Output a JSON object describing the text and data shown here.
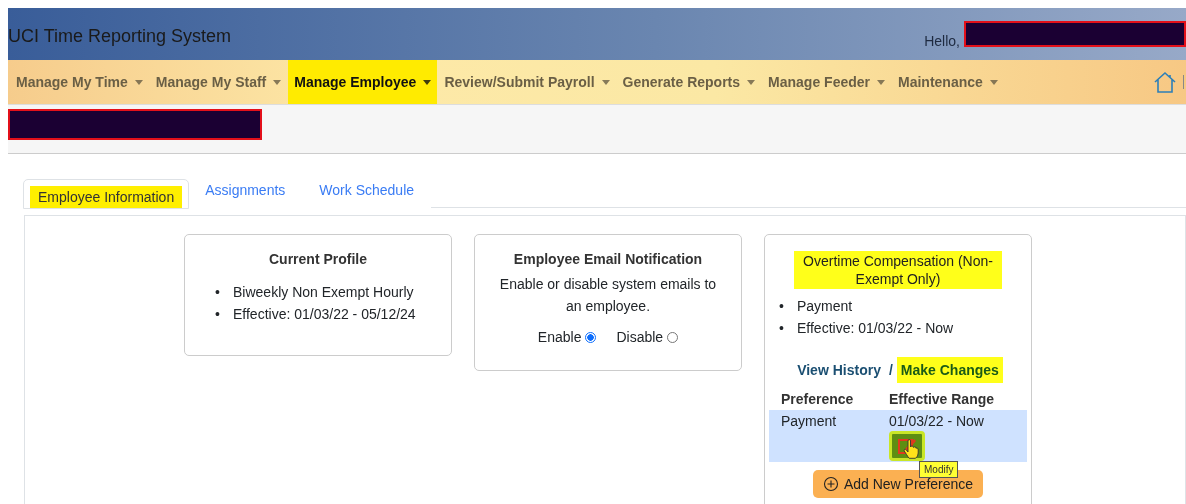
{
  "header": {
    "title": "UCI Time Reporting System",
    "greeting": "Hello,"
  },
  "nav": [
    {
      "label": "Manage My Time",
      "selected": false
    },
    {
      "label": "Manage My Staff",
      "selected": false
    },
    {
      "label": "Manage Employee",
      "selected": true
    },
    {
      "label": "Review/Submit Payroll",
      "selected": false
    },
    {
      "label": "Generate Reports",
      "selected": false
    },
    {
      "label": "Manage Feeder",
      "selected": false
    },
    {
      "label": "Maintenance",
      "selected": false
    }
  ],
  "tabs": [
    {
      "label": "Employee Information",
      "selected": true
    },
    {
      "label": "Assignments",
      "selected": false
    },
    {
      "label": "Work Schedule",
      "selected": false
    }
  ],
  "current_profile": {
    "title": "Current Profile",
    "bullet": "•",
    "items": [
      "Biweekly Non Exempt Hourly",
      "Effective: 01/03/22 - 05/12/24"
    ]
  },
  "email_notification": {
    "title": "Employee Email Notification",
    "description": "Enable or disable system emails to an employee.",
    "options": [
      {
        "label": "Enable",
        "selected": true
      },
      {
        "label": "Disable",
        "selected": false
      }
    ]
  },
  "overtime": {
    "title": "Overtime Compensation (Non-Exempt Only)",
    "title_highlighted": true,
    "bullet": "•",
    "items": [
      "Payment",
      "Effective: 01/03/22 - Now"
    ],
    "links": [
      {
        "label": "View History",
        "highlighted": false
      },
      {
        "label": "Make Changes",
        "highlighted": true
      }
    ],
    "separator": "/",
    "columns": [
      "Preference",
      "Effective Range"
    ],
    "rows": [
      {
        "preference": "Payment",
        "range": "01/03/22 - Now",
        "selected": true
      }
    ],
    "tooltip": "Modify",
    "add_button": "Add New Preference"
  }
}
